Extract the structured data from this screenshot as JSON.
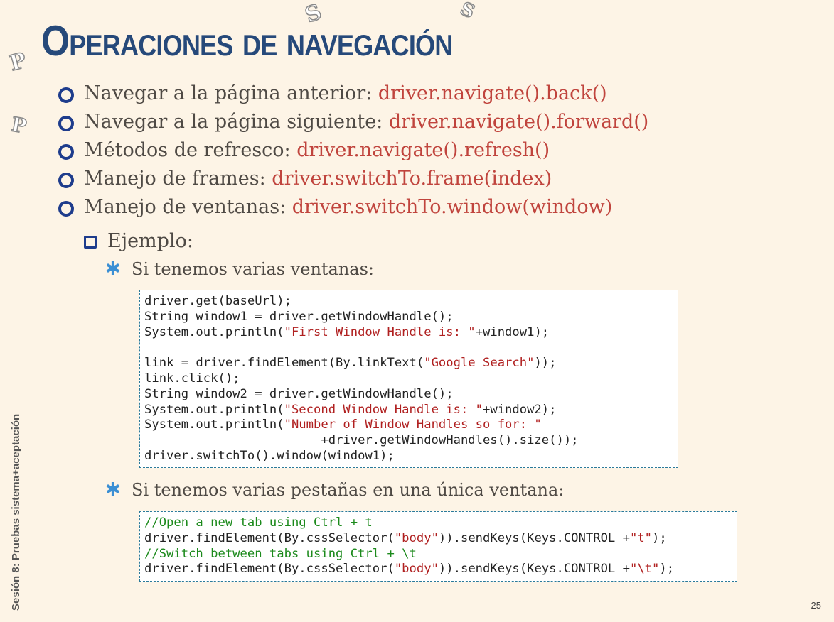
{
  "slide": {
    "title": "Operaciones de navegación",
    "page_number": "25",
    "sidebar_text": "Sesión 8: Pruebas sistema+aceptación"
  },
  "bullets": [
    {
      "text": "Navegar a la página anterior: ",
      "code": "driver.navigate().back()"
    },
    {
      "text": "Navegar a la página siguiente: ",
      "code": "driver.navigate().forward()"
    },
    {
      "text": "Métodos de refresco: ",
      "code": "driver.navigate().refresh()"
    },
    {
      "text": "Manejo de frames: ",
      "code": "driver.switchTo.frame(index)"
    },
    {
      "text": "Manejo de ventanas: ",
      "code": "driver.switchTo.window(window)"
    }
  ],
  "example": {
    "label": "Ejemplo:",
    "sub1": "Si tenemos varias ventanas:",
    "sub2": "Si tenemos varias pestañas en una única ventana:"
  },
  "code1": [
    [
      {
        "t": "driver.get(baseUrl);",
        "c": ""
      }
    ],
    [
      {
        "t": "String window1 = driver.getWindowHandle();",
        "c": ""
      }
    ],
    [
      {
        "t": "System.out.println(",
        "c": ""
      },
      {
        "t": "\"First Window Handle is: \"",
        "c": "str"
      },
      {
        "t": "+window1);",
        "c": ""
      }
    ],
    [
      {
        "t": "",
        "c": ""
      }
    ],
    [
      {
        "t": "link = driver.findElement(By.linkText(",
        "c": ""
      },
      {
        "t": "\"Google Search\"",
        "c": "str"
      },
      {
        "t": "));",
        "c": ""
      }
    ],
    [
      {
        "t": "link.click();",
        "c": ""
      }
    ],
    [
      {
        "t": "String window2 = driver.getWindowHandle();",
        "c": ""
      }
    ],
    [
      {
        "t": "System.out.println(",
        "c": ""
      },
      {
        "t": "\"Second Window Handle is: \"",
        "c": "str"
      },
      {
        "t": "+window2);",
        "c": ""
      }
    ],
    [
      {
        "t": "System.out.println(",
        "c": ""
      },
      {
        "t": "\"Number of Window Handles so for: \"",
        "c": "str"
      }
    ],
    [
      {
        "t": "                        +driver.getWindowHandles().size());",
        "c": ""
      }
    ],
    [
      {
        "t": "driver.switchTo().window(window1);",
        "c": ""
      }
    ]
  ],
  "code2": [
    [
      {
        "t": "//Open a new tab using Ctrl + t",
        "c": "cmt"
      }
    ],
    [
      {
        "t": "driver.findElement(By.cssSelector(",
        "c": ""
      },
      {
        "t": "\"body\"",
        "c": "str"
      },
      {
        "t": ")).sendKeys(Keys.CONTROL +",
        "c": ""
      },
      {
        "t": "\"t\"",
        "c": "str"
      },
      {
        "t": ");",
        "c": ""
      }
    ],
    [
      {
        "t": "//Switch between tabs using Ctrl + \\t",
        "c": "cmt"
      }
    ],
    [
      {
        "t": "driver.findElement(By.cssSelector(",
        "c": ""
      },
      {
        "t": "\"body\"",
        "c": "str"
      },
      {
        "t": ")).sendKeys(Keys.CONTROL +",
        "c": ""
      },
      {
        "t": "\"\\t\"",
        "c": "str"
      },
      {
        "t": ");",
        "c": ""
      }
    ]
  ],
  "colors": {
    "title": "#26497a",
    "bullet": "#1e3c8c",
    "code_inline": "#c0443d",
    "star": "#3b8fd4"
  }
}
